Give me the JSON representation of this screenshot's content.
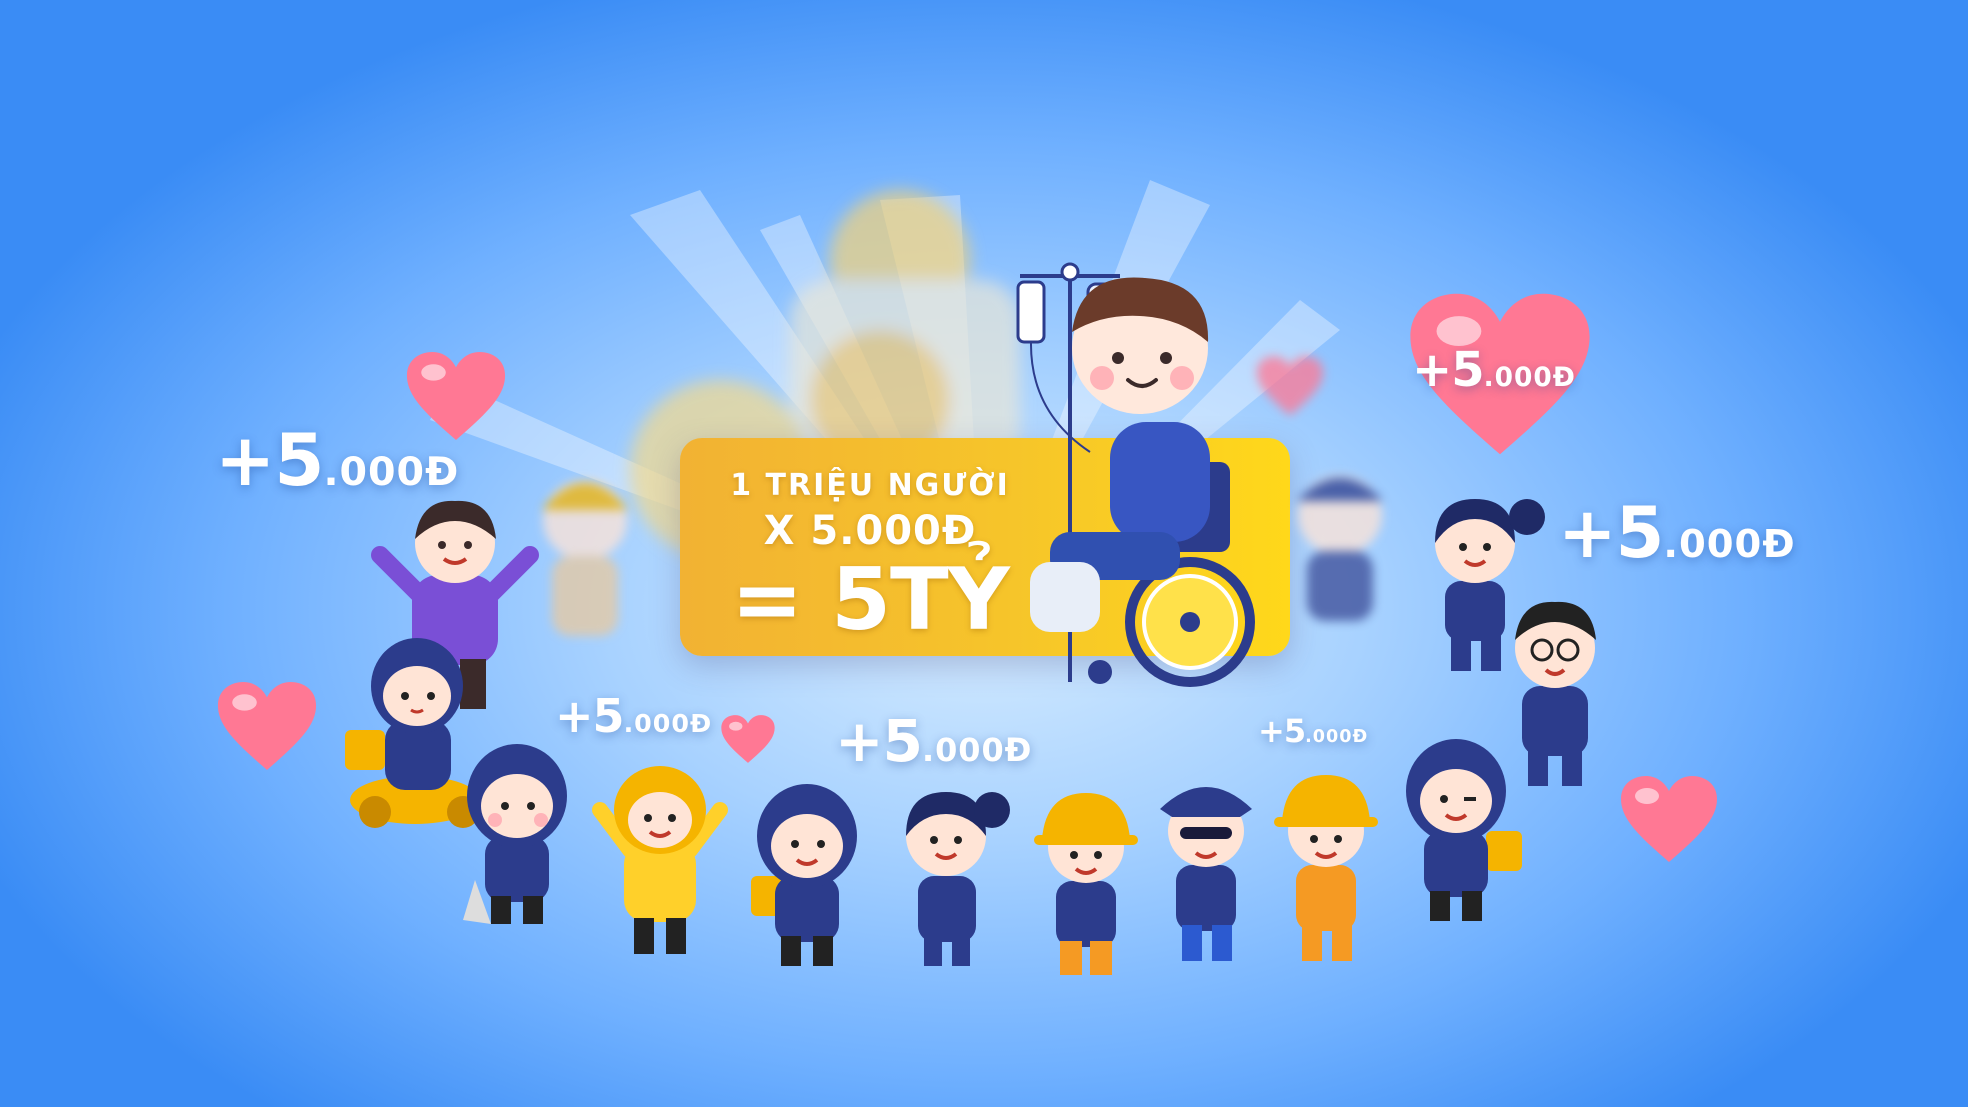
{
  "banner": {
    "line1": "1 TRIỆU NGƯỜI",
    "line2": "X 5.000Đ",
    "line3": "= 5TỶ"
  },
  "donation_labels": [
    {
      "amount": "+5",
      "unit": ".000Đ"
    },
    {
      "amount": "+5",
      "unit": ".000Đ"
    },
    {
      "amount": "+5",
      "unit": ".000Đ"
    },
    {
      "amount": "+5",
      "unit": ".000Đ"
    },
    {
      "amount": "+5",
      "unit": ".000Đ"
    },
    {
      "amount": "+5",
      "unit": ".000Đ"
    }
  ],
  "colors": {
    "background": "#5ea6f7",
    "card": "#f6c52a",
    "heart": "#ff6f8f",
    "uniform": "#2c3c8c",
    "helmet": "#f5b400"
  }
}
